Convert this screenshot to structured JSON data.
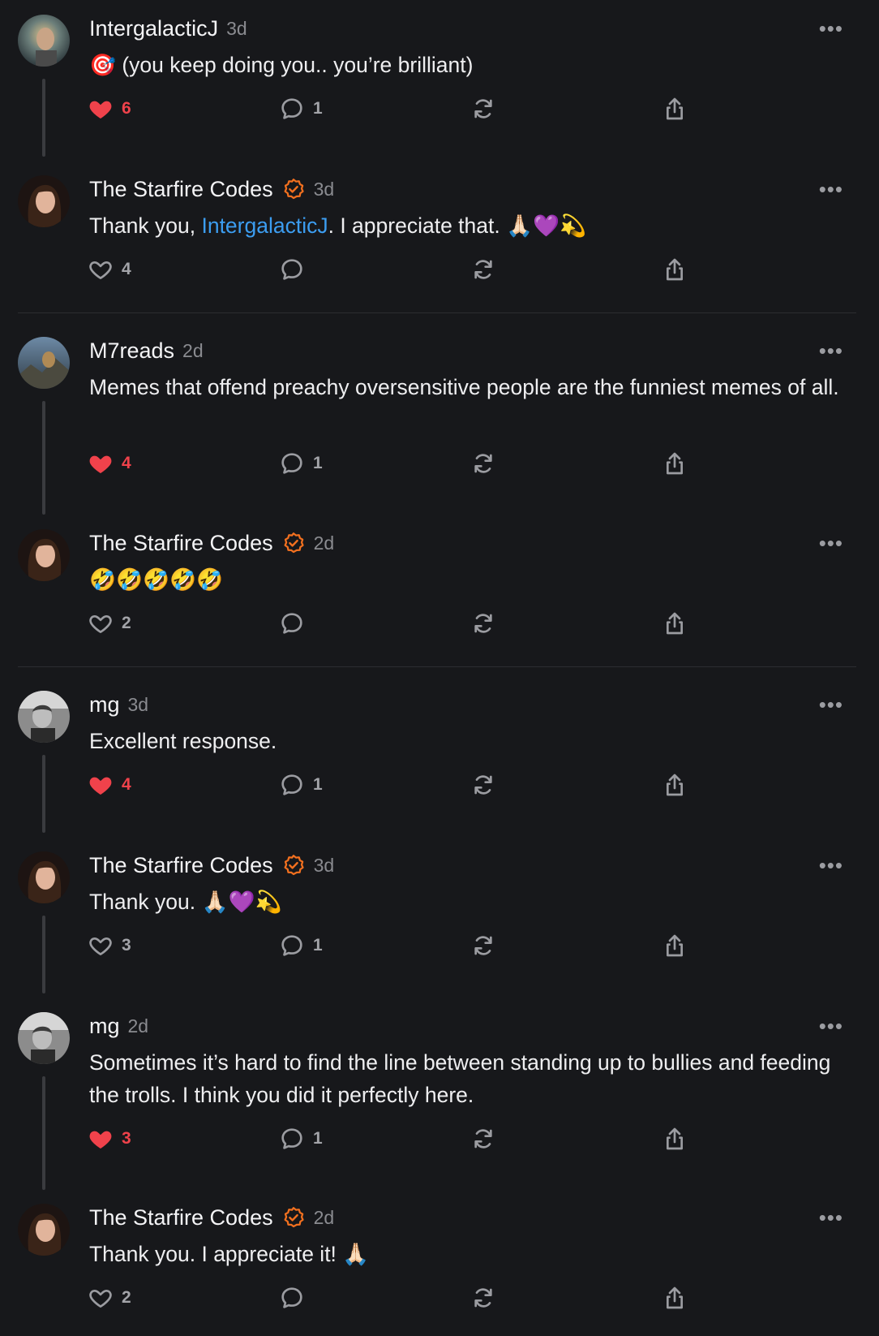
{
  "posts": [
    {
      "author": "IntergalacticJ",
      "verified": false,
      "time": "3d",
      "text": "🎯 (you keep doing you.. you’re brilliant)",
      "likes": "6",
      "liked": true,
      "replies": "1",
      "avatar": "intergalactic"
    },
    {
      "author": "The Starfire Codes",
      "verified": true,
      "time": "3d",
      "text_before": "Thank you, ",
      "mention": "IntergalacticJ",
      "text_after": ". I appreciate that. 🙏🏻💜💫",
      "likes": "4",
      "liked": false,
      "replies": "",
      "avatar": "starfire"
    },
    {
      "author": "M7reads",
      "verified": false,
      "time": "2d",
      "text": "Memes that offend preachy oversensitive people are the funniest memes of all.",
      "likes": "4",
      "liked": true,
      "replies": "1",
      "avatar": "m7"
    },
    {
      "author": "The Starfire Codes",
      "verified": true,
      "time": "2d",
      "text": "🤣🤣🤣🤣🤣",
      "likes": "2",
      "liked": false,
      "replies": "",
      "avatar": "starfire"
    },
    {
      "author": "mg",
      "verified": false,
      "time": "3d",
      "text": "Excellent response.",
      "likes": "4",
      "liked": true,
      "replies": "1",
      "avatar": "mg"
    },
    {
      "author": "The Starfire Codes",
      "verified": true,
      "time": "3d",
      "text": "Thank you. 🙏🏻💜💫",
      "likes": "3",
      "liked": false,
      "replies": "1",
      "avatar": "starfire"
    },
    {
      "author": "mg",
      "verified": false,
      "time": "2d",
      "text": "Sometimes it’s hard to find the line between standing up to bullies and feeding the trolls. I think you did it perfectly here.",
      "likes": "3",
      "liked": true,
      "replies": "1",
      "avatar": "mg"
    },
    {
      "author": "The Starfire Codes",
      "verified": true,
      "time": "2d",
      "text": "Thank you. I appreciate it! 🙏🏻",
      "likes": "2",
      "liked": false,
      "replies": "",
      "avatar": "starfire"
    }
  ],
  "icons": {
    "like": "heart-icon",
    "reply": "comment-icon",
    "repost": "repost-icon",
    "share": "share-icon",
    "more": "more-icon",
    "verified": "verified-check-icon"
  },
  "colors": {
    "background": "#17181b",
    "liked": "#f0424b",
    "mention": "#3c9df0",
    "verified": "#f2701f"
  }
}
